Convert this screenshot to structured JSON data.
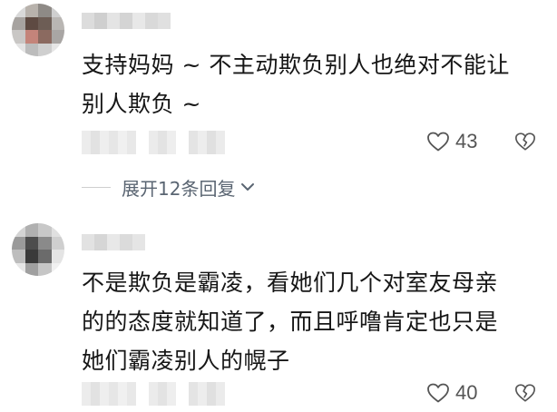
{
  "comments": [
    {
      "text_line_1": "支持妈妈 ~ 不主动欺负别人也绝对不能让",
      "text_line_2": "别人欺负 ~",
      "likes": "43"
    },
    {
      "text_line_1": "不是欺负是霸凌，看她们几个对室友母亲",
      "text_line_2": "的的态度就知道了，而且呼噜肯定也只是",
      "text_line_3": "她们霸凌别人的幌子",
      "likes": "40"
    }
  ],
  "replies": {
    "expand_label": "展开12条回复"
  },
  "icons": {
    "like": "heart-outline-icon",
    "dislike": "broken-heart-icon",
    "expand": "chevron-down-icon"
  },
  "colors": {
    "text": "#161616",
    "muted": "#5a6572",
    "icon": "#555555"
  }
}
